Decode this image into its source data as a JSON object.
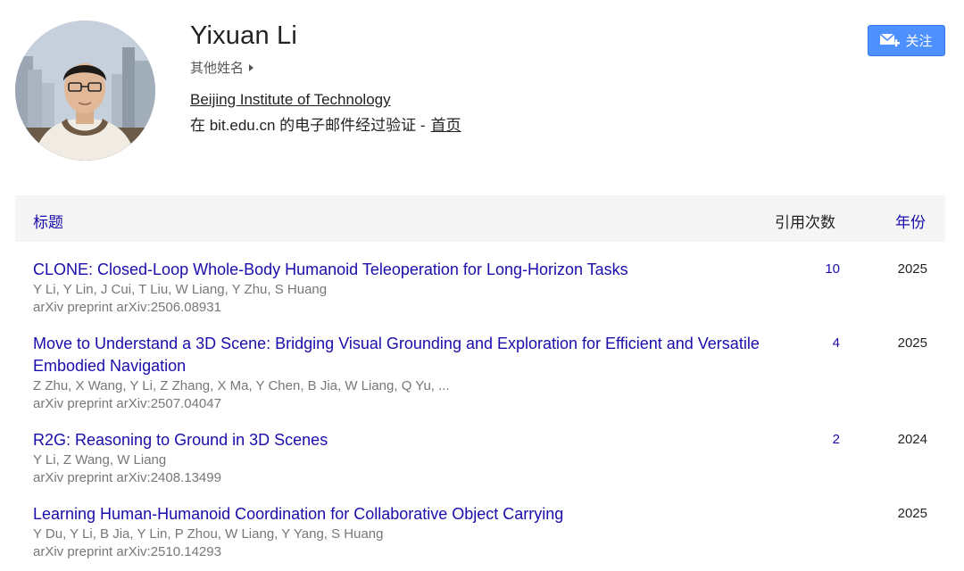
{
  "profile": {
    "name": "Yixuan Li",
    "other_names_label": "其他姓名",
    "affiliation": "Beijing Institute of Technology",
    "verified_text": "在 bit.edu.cn 的电子邮件经过验证 -",
    "homepage_label": "首页",
    "avatar_icon": "profile-photo"
  },
  "actions": {
    "follow_label": "关注",
    "follow_icon": "mail-plus-icon",
    "accent_color": "#4d90fe"
  },
  "table": {
    "headers": {
      "title": "标题",
      "cited_by": "引用次数",
      "year": "年份"
    },
    "rows": [
      {
        "title": "CLONE: Closed-Loop Whole-Body Humanoid Teleoperation for Long-Horizon Tasks",
        "authors": "Y Li, Y Lin, J Cui, T Liu, W Liang, Y Zhu, S Huang",
        "venue": "arXiv preprint arXiv:2506.08931",
        "cited_by": "10",
        "year": "2025"
      },
      {
        "title": "Move to Understand a 3D Scene: Bridging Visual Grounding and Exploration for Efficient and Versatile Embodied Navigation",
        "authors": "Z Zhu, X Wang, Y Li, Z Zhang, X Ma, Y Chen, B Jia, W Liang, Q Yu, ...",
        "venue": "arXiv preprint arXiv:2507.04047",
        "cited_by": "4",
        "year": "2025"
      },
      {
        "title": "R2G: Reasoning to Ground in 3D Scenes",
        "authors": "Y Li, Z Wang, W Liang",
        "venue": "arXiv preprint arXiv:2408.13499",
        "cited_by": "2",
        "year": "2024"
      },
      {
        "title": "Learning Human-Humanoid Coordination for Collaborative Object Carrying",
        "authors": "Y Du, Y Li, B Jia, Y Lin, P Zhou, W Liang, Y Yang, S Huang",
        "venue": "arXiv preprint arXiv:2510.14293",
        "cited_by": "",
        "year": "2025"
      }
    ]
  }
}
